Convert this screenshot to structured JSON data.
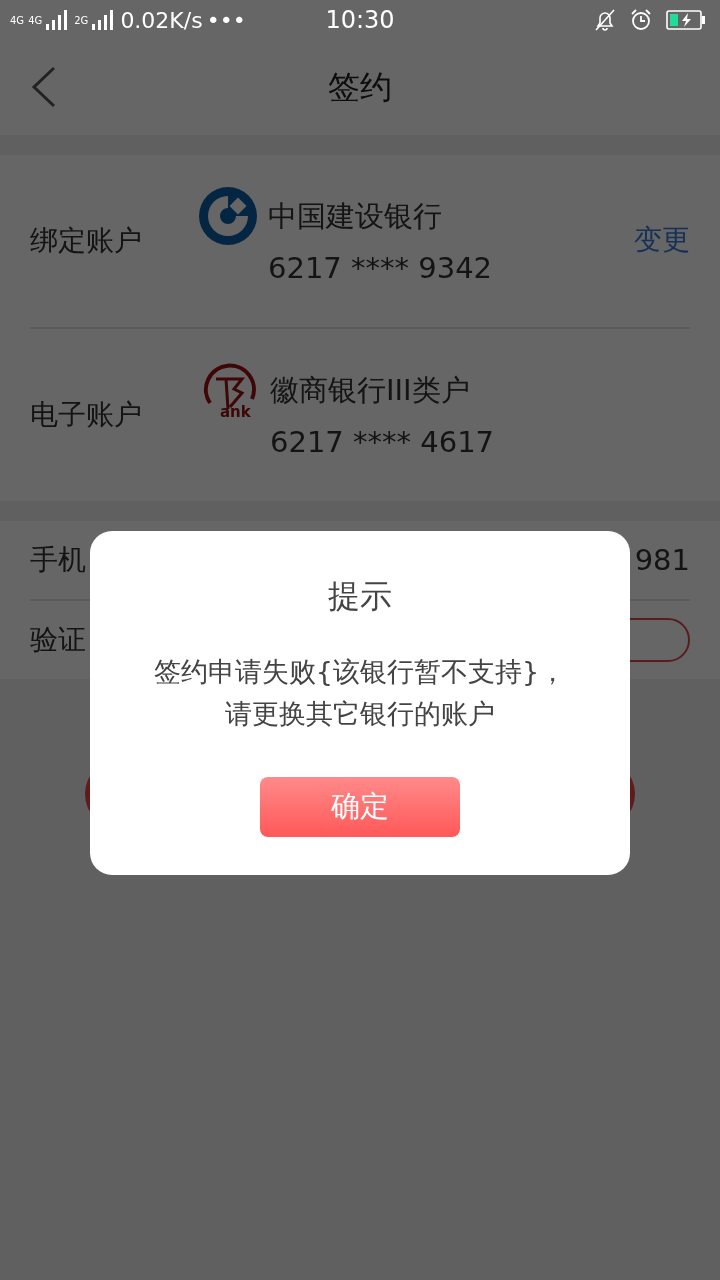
{
  "status_bar": {
    "network_1": "4G",
    "network_2": "4G",
    "network_3": "2G",
    "speed": "0.02K/s",
    "more": "•••",
    "time": "10:30"
  },
  "header": {
    "title": "签约"
  },
  "accounts": [
    {
      "kind": "ccb",
      "label": "绑定账户",
      "bank": "中国建设银行",
      "number": "6217 **** 9342",
      "action": "变更"
    },
    {
      "kind": "huishang",
      "label": "电子账户",
      "bank": "徽商银行III类户",
      "number": "6217 **** 4617",
      "logo_text": "ank"
    }
  ],
  "phone_row": {
    "label": "手机",
    "value": "981"
  },
  "code_row": {
    "label": "验证"
  },
  "dialog": {
    "title": "提示",
    "message": [
      "签约申请失败{该银行暂不支持}，",
      "请更换其它银行的账户"
    ],
    "button": "确定"
  }
}
